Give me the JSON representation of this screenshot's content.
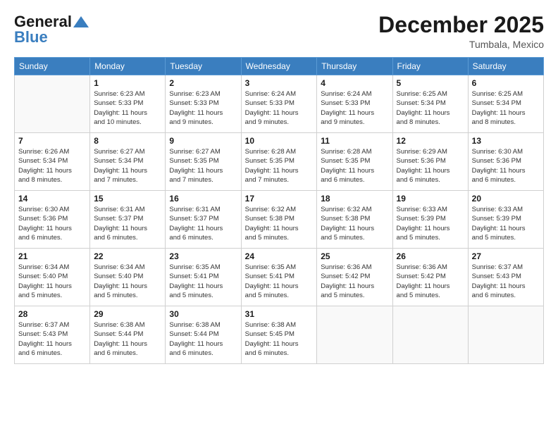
{
  "header": {
    "logo_general": "General",
    "logo_blue": "Blue",
    "month_title": "December 2025",
    "location": "Tumbala, Mexico"
  },
  "days_of_week": [
    "Sunday",
    "Monday",
    "Tuesday",
    "Wednesday",
    "Thursday",
    "Friday",
    "Saturday"
  ],
  "weeks": [
    [
      {
        "day": "",
        "info": ""
      },
      {
        "day": "1",
        "info": "Sunrise: 6:23 AM\nSunset: 5:33 PM\nDaylight: 11 hours\nand 10 minutes."
      },
      {
        "day": "2",
        "info": "Sunrise: 6:23 AM\nSunset: 5:33 PM\nDaylight: 11 hours\nand 9 minutes."
      },
      {
        "day": "3",
        "info": "Sunrise: 6:24 AM\nSunset: 5:33 PM\nDaylight: 11 hours\nand 9 minutes."
      },
      {
        "day": "4",
        "info": "Sunrise: 6:24 AM\nSunset: 5:33 PM\nDaylight: 11 hours\nand 9 minutes."
      },
      {
        "day": "5",
        "info": "Sunrise: 6:25 AM\nSunset: 5:34 PM\nDaylight: 11 hours\nand 8 minutes."
      },
      {
        "day": "6",
        "info": "Sunrise: 6:25 AM\nSunset: 5:34 PM\nDaylight: 11 hours\nand 8 minutes."
      }
    ],
    [
      {
        "day": "7",
        "info": "Sunrise: 6:26 AM\nSunset: 5:34 PM\nDaylight: 11 hours\nand 8 minutes."
      },
      {
        "day": "8",
        "info": "Sunrise: 6:27 AM\nSunset: 5:34 PM\nDaylight: 11 hours\nand 7 minutes."
      },
      {
        "day": "9",
        "info": "Sunrise: 6:27 AM\nSunset: 5:35 PM\nDaylight: 11 hours\nand 7 minutes."
      },
      {
        "day": "10",
        "info": "Sunrise: 6:28 AM\nSunset: 5:35 PM\nDaylight: 11 hours\nand 7 minutes."
      },
      {
        "day": "11",
        "info": "Sunrise: 6:28 AM\nSunset: 5:35 PM\nDaylight: 11 hours\nand 6 minutes."
      },
      {
        "day": "12",
        "info": "Sunrise: 6:29 AM\nSunset: 5:36 PM\nDaylight: 11 hours\nand 6 minutes."
      },
      {
        "day": "13",
        "info": "Sunrise: 6:30 AM\nSunset: 5:36 PM\nDaylight: 11 hours\nand 6 minutes."
      }
    ],
    [
      {
        "day": "14",
        "info": "Sunrise: 6:30 AM\nSunset: 5:36 PM\nDaylight: 11 hours\nand 6 minutes."
      },
      {
        "day": "15",
        "info": "Sunrise: 6:31 AM\nSunset: 5:37 PM\nDaylight: 11 hours\nand 6 minutes."
      },
      {
        "day": "16",
        "info": "Sunrise: 6:31 AM\nSunset: 5:37 PM\nDaylight: 11 hours\nand 6 minutes."
      },
      {
        "day": "17",
        "info": "Sunrise: 6:32 AM\nSunset: 5:38 PM\nDaylight: 11 hours\nand 5 minutes."
      },
      {
        "day": "18",
        "info": "Sunrise: 6:32 AM\nSunset: 5:38 PM\nDaylight: 11 hours\nand 5 minutes."
      },
      {
        "day": "19",
        "info": "Sunrise: 6:33 AM\nSunset: 5:39 PM\nDaylight: 11 hours\nand 5 minutes."
      },
      {
        "day": "20",
        "info": "Sunrise: 6:33 AM\nSunset: 5:39 PM\nDaylight: 11 hours\nand 5 minutes."
      }
    ],
    [
      {
        "day": "21",
        "info": "Sunrise: 6:34 AM\nSunset: 5:40 PM\nDaylight: 11 hours\nand 5 minutes."
      },
      {
        "day": "22",
        "info": "Sunrise: 6:34 AM\nSunset: 5:40 PM\nDaylight: 11 hours\nand 5 minutes."
      },
      {
        "day": "23",
        "info": "Sunrise: 6:35 AM\nSunset: 5:41 PM\nDaylight: 11 hours\nand 5 minutes."
      },
      {
        "day": "24",
        "info": "Sunrise: 6:35 AM\nSunset: 5:41 PM\nDaylight: 11 hours\nand 5 minutes."
      },
      {
        "day": "25",
        "info": "Sunrise: 6:36 AM\nSunset: 5:42 PM\nDaylight: 11 hours\nand 5 minutes."
      },
      {
        "day": "26",
        "info": "Sunrise: 6:36 AM\nSunset: 5:42 PM\nDaylight: 11 hours\nand 5 minutes."
      },
      {
        "day": "27",
        "info": "Sunrise: 6:37 AM\nSunset: 5:43 PM\nDaylight: 11 hours\nand 6 minutes."
      }
    ],
    [
      {
        "day": "28",
        "info": "Sunrise: 6:37 AM\nSunset: 5:43 PM\nDaylight: 11 hours\nand 6 minutes."
      },
      {
        "day": "29",
        "info": "Sunrise: 6:38 AM\nSunset: 5:44 PM\nDaylight: 11 hours\nand 6 minutes."
      },
      {
        "day": "30",
        "info": "Sunrise: 6:38 AM\nSunset: 5:44 PM\nDaylight: 11 hours\nand 6 minutes."
      },
      {
        "day": "31",
        "info": "Sunrise: 6:38 AM\nSunset: 5:45 PM\nDaylight: 11 hours\nand 6 minutes."
      },
      {
        "day": "",
        "info": ""
      },
      {
        "day": "",
        "info": ""
      },
      {
        "day": "",
        "info": ""
      }
    ]
  ]
}
